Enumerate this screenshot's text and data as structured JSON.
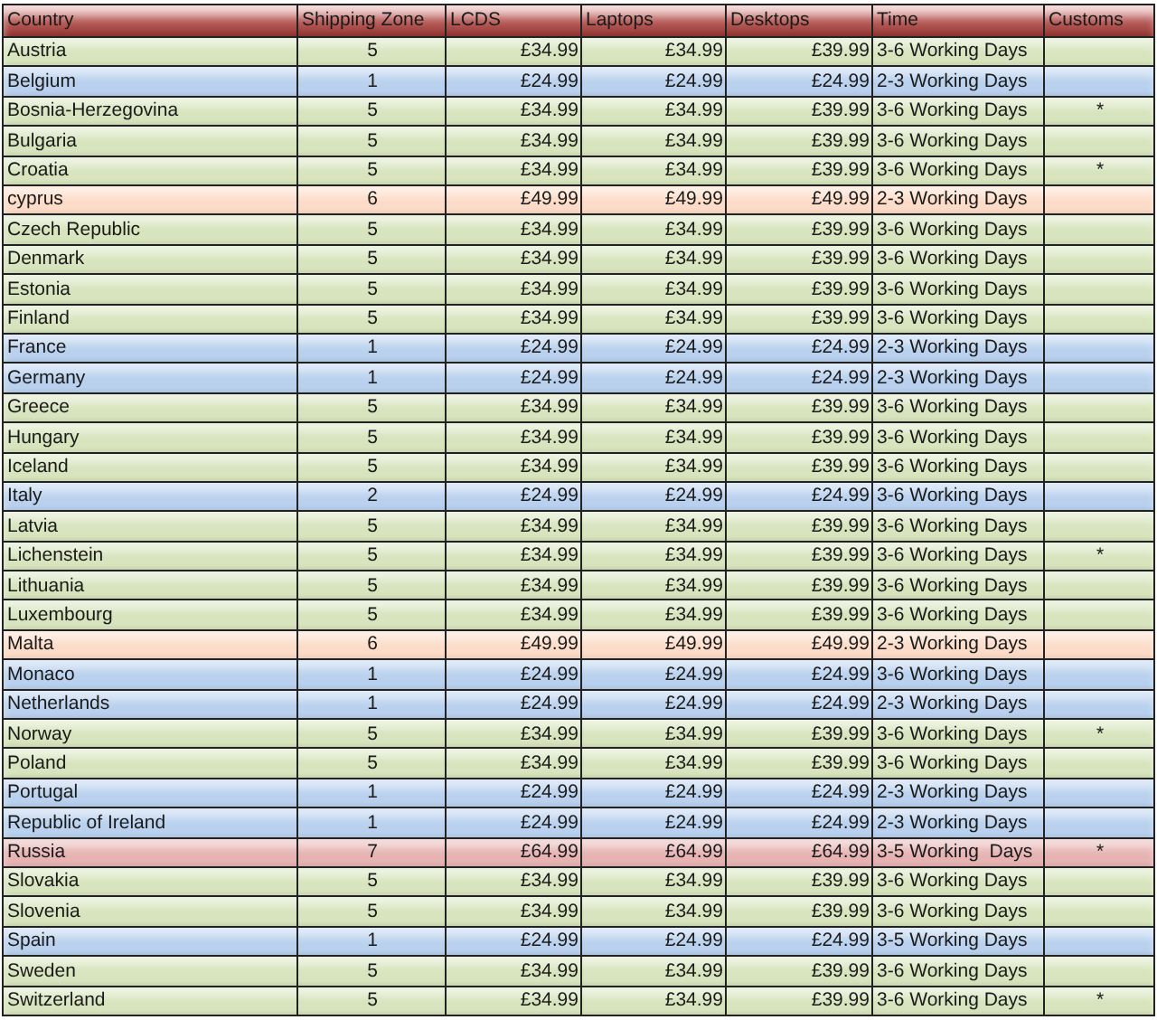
{
  "table": {
    "columns": [
      "Country",
      "Shipping Zone",
      "LCDS",
      "Laptops",
      "Desktops",
      "Time",
      "Customs"
    ],
    "rows": [
      {
        "country": "Austria",
        "zone": "5",
        "lcds": "£34.99",
        "laptops": "£34.99",
        "desktops": "£39.99",
        "time": "3-6 Working Days",
        "color": "#d7e4bd"
      },
      {
        "country": "Belgium",
        "zone": "1",
        "lcds": "£24.99",
        "laptops": "£24.99",
        "desktops": "£24.99",
        "time": "2-3 Working Days",
        "color": "#b9d1ee"
      },
      {
        "country": "Bosnia-Herzegovina",
        "zone": "5",
        "lcds": "£34.99",
        "laptops": "£34.99",
        "desktops": "£39.99",
        "time": "3-6 Working Days",
        "customs": "*",
        "color": "#d7e4bd"
      },
      {
        "country": "Bulgaria",
        "zone": "5",
        "lcds": "£34.99",
        "laptops": "£34.99",
        "desktops": "£39.99",
        "time": "3-6 Working Days",
        "color": "#d7e4bd"
      },
      {
        "country": "Croatia",
        "zone": "5",
        "lcds": "£34.99",
        "laptops": "£34.99",
        "desktops": "£39.99",
        "time": "3-6 Working Days",
        "customs": "*",
        "color": "#d7e4bd"
      },
      {
        "country": "cyprus",
        "zone": "6",
        "lcds": "£49.99",
        "laptops": "£49.99",
        "desktops": "£49.99",
        "time": "2-3 Working Days",
        "color": "#fcdcc8"
      },
      {
        "country": "Czech Republic",
        "zone": "5",
        "lcds": "£34.99",
        "laptops": "£34.99",
        "desktops": "£39.99",
        "time": "3-6 Working Days",
        "color": "#d7e4bd"
      },
      {
        "country": "Denmark",
        "zone": "5",
        "lcds": "£34.99",
        "laptops": "£34.99",
        "desktops": "£39.99",
        "time": "3-6 Working Days",
        "color": "#d7e4bd"
      },
      {
        "country": "Estonia",
        "zone": "5",
        "lcds": "£34.99",
        "laptops": "£34.99",
        "desktops": "£39.99",
        "time": "3-6 Working Days",
        "color": "#d7e4bd"
      },
      {
        "country": "Finland",
        "zone": "5",
        "lcds": "£34.99",
        "laptops": "£34.99",
        "desktops": "£39.99",
        "time": "3-6 Working Days",
        "color": "#d7e4bd"
      },
      {
        "country": "France",
        "zone": "1",
        "lcds": "£24.99",
        "laptops": "£24.99",
        "desktops": "£24.99",
        "time": "2-3 Working Days",
        "color": "#b9d1ee"
      },
      {
        "country": "Germany",
        "zone": "1",
        "lcds": "£24.99",
        "laptops": "£24.99",
        "desktops": "£24.99",
        "time": "2-3 Working Days",
        "color": "#b9d1ee"
      },
      {
        "country": "Greece",
        "zone": "5",
        "lcds": "£34.99",
        "laptops": "£34.99",
        "desktops": "£39.99",
        "time": "3-6 Working Days",
        "color": "#d7e4bd"
      },
      {
        "country": "Hungary",
        "zone": "5",
        "lcds": "£34.99",
        "laptops": "£34.99",
        "desktops": "£39.99",
        "time": "3-6 Working Days",
        "color": "#d7e4bd"
      },
      {
        "country": "Iceland",
        "zone": "5",
        "lcds": "£34.99",
        "laptops": "£34.99",
        "desktops": "£39.99",
        "time": "3-6 Working Days",
        "color": "#d7e4bd"
      },
      {
        "country": "Italy",
        "zone": "2",
        "lcds": "£24.99",
        "laptops": "£24.99",
        "desktops": "£24.99",
        "time": "3-6 Working Days",
        "color": "#b9d1ee"
      },
      {
        "country": "Latvia",
        "zone": "5",
        "lcds": "£34.99",
        "laptops": "£34.99",
        "desktops": "£39.99",
        "time": "3-6 Working Days",
        "color": "#d7e4bd"
      },
      {
        "country": "Lichenstein",
        "zone": "5",
        "lcds": "£34.99",
        "laptops": "£34.99",
        "desktops": "£39.99",
        "time": "3-6 Working Days",
        "customs": "*",
        "color": "#d7e4bd"
      },
      {
        "country": "Lithuania",
        "zone": "5",
        "lcds": "£34.99",
        "laptops": "£34.99",
        "desktops": "£39.99",
        "time": "3-6 Working Days",
        "color": "#d7e4bd"
      },
      {
        "country": "Luxembourg",
        "zone": "5",
        "lcds": "£34.99",
        "laptops": "£34.99",
        "desktops": "£39.99",
        "time": "3-6 Working Days",
        "color": "#d7e4bd"
      },
      {
        "country": "Malta",
        "zone": "6",
        "lcds": "£49.99",
        "laptops": "£49.99",
        "desktops": "£49.99",
        "time": "2-3 Working Days",
        "color": "#fcdcc8"
      },
      {
        "country": "Monaco",
        "zone": "1",
        "lcds": "£24.99",
        "laptops": "£24.99",
        "desktops": "£24.99",
        "time": "3-6 Working Days",
        "color": "#b9d1ee"
      },
      {
        "country": "Netherlands",
        "zone": "1",
        "lcds": "£24.99",
        "laptops": "£24.99",
        "desktops": "£24.99",
        "time": "2-3 Working Days",
        "color": "#b9d1ee"
      },
      {
        "country": "Norway",
        "zone": "5",
        "lcds": "£34.99",
        "laptops": "£34.99",
        "desktops": "£39.99",
        "time": "3-6 Working Days",
        "customs": "*",
        "color": "#d7e4bd"
      },
      {
        "country": "Poland",
        "zone": "5",
        "lcds": "£34.99",
        "laptops": "£34.99",
        "desktops": "£39.99",
        "time": "3-6 Working Days",
        "color": "#d7e4bd"
      },
      {
        "country": "Portugal",
        "zone": "1",
        "lcds": "£24.99",
        "laptops": "£24.99",
        "desktops": "£24.99",
        "time": "2-3 Working Days",
        "color": "#b9d1ee"
      },
      {
        "country": "Republic of Ireland",
        "zone": "1",
        "lcds": "£24.99",
        "laptops": "£24.99",
        "desktops": "£24.99",
        "time": "2-3 Working Days",
        "color": "#b9d1ee"
      },
      {
        "country": "Russia",
        "zone": "7",
        "lcds": "£64.99",
        "laptops": "£64.99",
        "desktops": "£64.99",
        "time": "3-5 Working  Days",
        "customs": "*",
        "color": "#e6b3b2"
      },
      {
        "country": "Slovakia",
        "zone": "5",
        "lcds": "£34.99",
        "laptops": "£34.99",
        "desktops": "£39.99",
        "time": "3-6 Working Days",
        "color": "#d7e4bd"
      },
      {
        "country": "Slovenia",
        "zone": "5",
        "lcds": "£34.99",
        "laptops": "£34.99",
        "desktops": "£39.99",
        "time": "3-6 Working Days",
        "color": "#d7e4bd"
      },
      {
        "country": "Spain",
        "zone": "1",
        "lcds": "£24.99",
        "laptops": "£24.99",
        "desktops": "£24.99",
        "time": "3-5 Working Days",
        "color": "#b9d1ee"
      },
      {
        "country": "Sweden",
        "zone": "5",
        "lcds": "£34.99",
        "laptops": "£34.99",
        "desktops": "£39.99",
        "time": "3-6 Working Days",
        "color": "#d7e4bd"
      },
      {
        "country": "Switzerland",
        "zone": "5",
        "lcds": "£34.99",
        "laptops": "£34.99",
        "desktops": "£39.99",
        "time": "3-6 Working Days",
        "customs": "*",
        "color": "#d7e4bd"
      }
    ]
  }
}
